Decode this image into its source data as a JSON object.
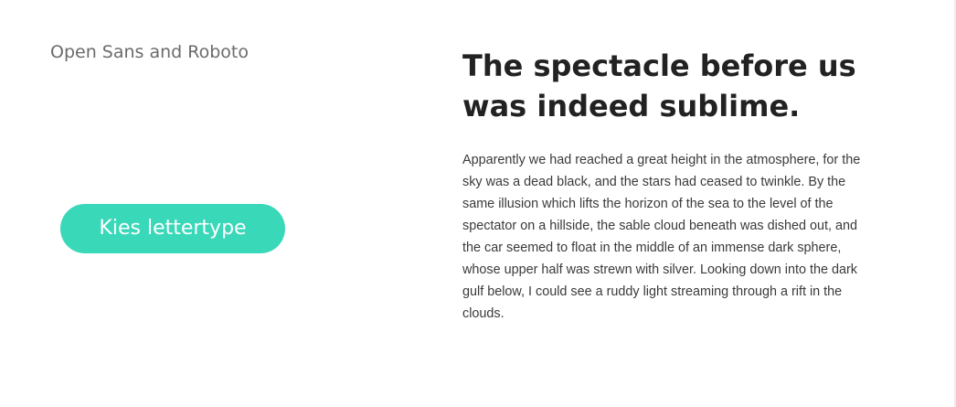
{
  "sample": {
    "font_label": "Open Sans and Roboto",
    "button_label": "Kies lettertype",
    "heading": "The spectacle before us was indeed sublime.",
    "body": "Apparently we had reached a great height in the atmosphere, for the sky was a dead black, and the stars had ceased to twinkle. By the same illusion which lifts the horizon of the sea to the level of the spectator on a hillside, the sable cloud beneath was dished out, and the car seemed to float in the middle of an immense dark sphere, whose upper half was strewn with silver. Looking down into the dark gulf below, I could see a ruddy light streaming through a rift in the clouds."
  },
  "colors": {
    "button_background": "#39d8b8",
    "heading_text": "#222222",
    "body_text": "#3a3a3a",
    "label_text": "#6b6b6b"
  }
}
